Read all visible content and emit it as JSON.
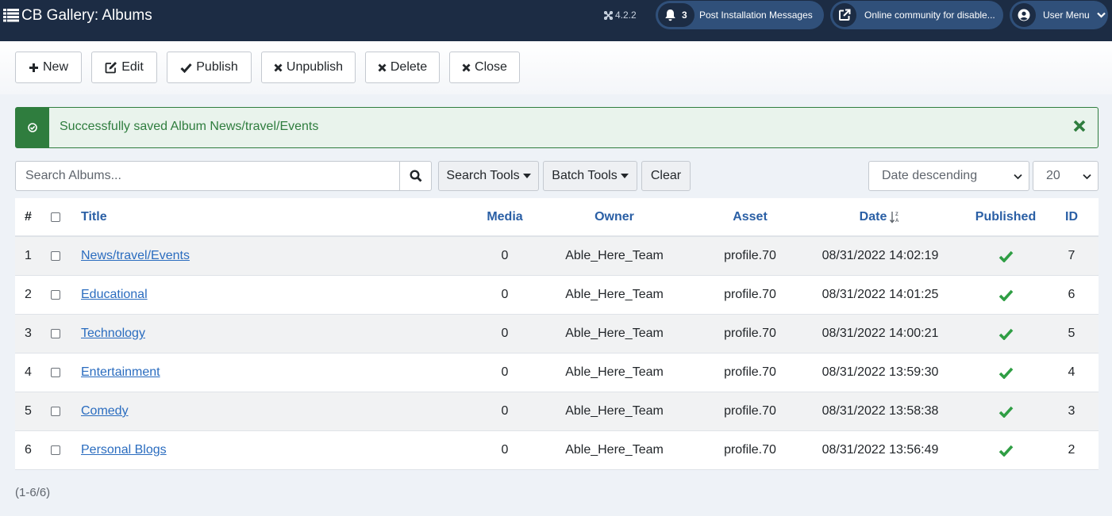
{
  "header": {
    "title": "CB Gallery: Albums",
    "version": "4.2.2",
    "notifications": {
      "count": "3",
      "label": "Post Installation Messages"
    },
    "community_label": "Online community for disable...",
    "user_menu_label": "User Menu"
  },
  "toolbar": {
    "new_label": "New",
    "edit_label": "Edit",
    "publish_label": "Publish",
    "unpublish_label": "Unpublish",
    "delete_label": "Delete",
    "close_label": "Close"
  },
  "alert": {
    "message": "Successfully saved Album News/travel/Events"
  },
  "filters": {
    "search_placeholder": "Search Albums...",
    "search_tools_label": "Search Tools",
    "batch_tools_label": "Batch Tools",
    "clear_label": "Clear",
    "sort_value": "Date descending",
    "limit_value": "20"
  },
  "table": {
    "headers": {
      "num": "#",
      "title": "Title",
      "media": "Media",
      "owner": "Owner",
      "asset": "Asset",
      "date": "Date",
      "published": "Published",
      "id": "ID"
    },
    "rows": [
      {
        "num": "1",
        "title": "News/travel/Events",
        "media": "0",
        "owner": "Able_Here_Team",
        "asset": "profile.70",
        "date": "08/31/2022 14:02:19",
        "published": true,
        "id": "7"
      },
      {
        "num": "2",
        "title": "Educational",
        "media": "0",
        "owner": "Able_Here_Team",
        "asset": "profile.70",
        "date": "08/31/2022 14:01:25",
        "published": true,
        "id": "6"
      },
      {
        "num": "3",
        "title": "Technology",
        "media": "0",
        "owner": "Able_Here_Team",
        "asset": "profile.70",
        "date": "08/31/2022 14:00:21",
        "published": true,
        "id": "5"
      },
      {
        "num": "4",
        "title": "Entertainment",
        "media": "0",
        "owner": "Able_Here_Team",
        "asset": "profile.70",
        "date": "08/31/2022 13:59:30",
        "published": true,
        "id": "4"
      },
      {
        "num": "5",
        "title": "Comedy",
        "media": "0",
        "owner": "Able_Here_Team",
        "asset": "profile.70",
        "date": "08/31/2022 13:58:38",
        "published": true,
        "id": "3"
      },
      {
        "num": "6",
        "title": "Personal Blogs",
        "media": "0",
        "owner": "Able_Here_Team",
        "asset": "profile.70",
        "date": "08/31/2022 13:56:49",
        "published": true,
        "id": "2"
      }
    ]
  },
  "pagination": {
    "count_text": "(1-6/6)"
  },
  "colors": {
    "header_bg": "#1c2c44",
    "pill_bg": "#30507a",
    "success": "#2f7d3e",
    "link": "#2a6cbf",
    "check": "#2f9e44"
  }
}
